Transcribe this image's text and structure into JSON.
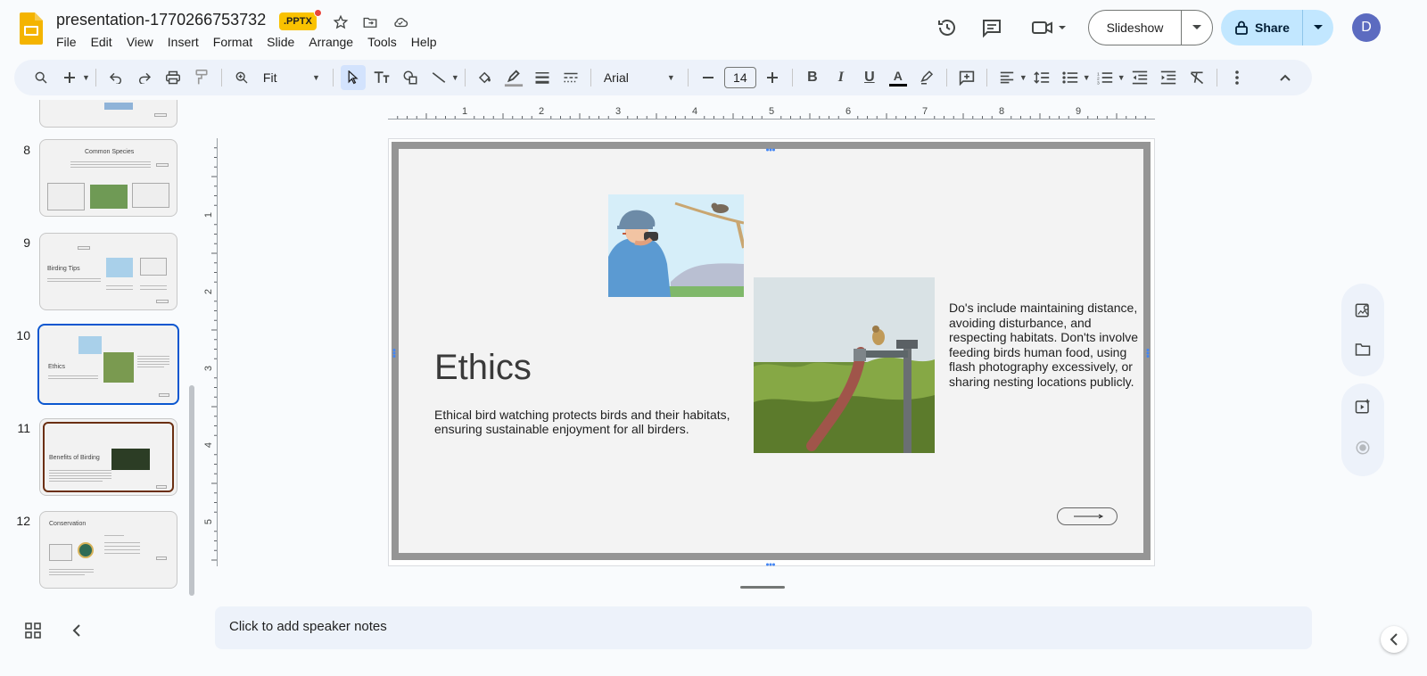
{
  "app": {
    "doc_title": "presentation-1770266753732",
    "file_badge": ".PPTX"
  },
  "menu": [
    "File",
    "Edit",
    "View",
    "Insert",
    "Format",
    "Slide",
    "Arrange",
    "Tools",
    "Help"
  ],
  "header_actions": {
    "slideshow_label": "Slideshow",
    "share_label": "Share",
    "avatar_letter": "D"
  },
  "toolbar": {
    "zoom_value": "Fit",
    "font_name": "Arial",
    "font_size": "14"
  },
  "ruler": {
    "horizontal_ticks": [
      "1",
      "2",
      "3",
      "4",
      "5",
      "6",
      "7",
      "8",
      "9"
    ],
    "vertical_ticks": [
      "1",
      "2",
      "3",
      "4",
      "5"
    ]
  },
  "filmstrip": {
    "slides": [
      {
        "number": "8",
        "title": "Common Species"
      },
      {
        "number": "9",
        "title": "Birding Tips"
      },
      {
        "number": "10",
        "title": "Ethics"
      },
      {
        "number": "11",
        "title": "Benefits of Birding"
      },
      {
        "number": "12",
        "title": "Conservation"
      }
    ]
  },
  "slide": {
    "title": "Ethics",
    "subtitle": "Ethical bird watching protects birds and their habitats, ensuring sustainable enjoyment for all birders.",
    "body": "Do's include maintaining distance, avoiding disturbance, and respecting habitats. Don'ts involve feeding birds human food, using flash photography excessively, or sharing nesting locations publicly."
  },
  "notes": {
    "placeholder": "Click to add speaker notes"
  },
  "colors": {
    "accent": "#0b57d0",
    "share_bg": "#c2e7ff",
    "toolbar_bg": "#edf2fa",
    "badge": "#f9c200"
  }
}
